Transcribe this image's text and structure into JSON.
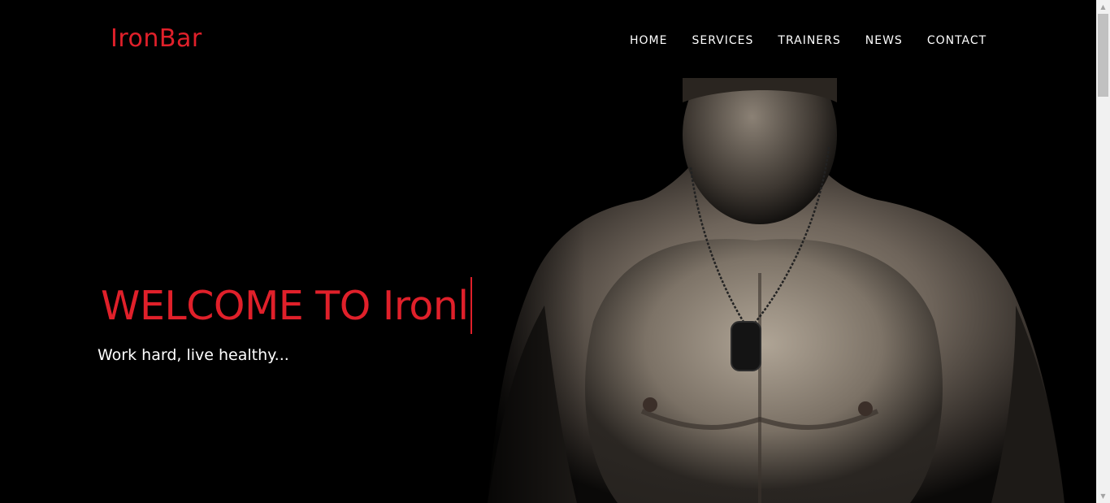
{
  "header": {
    "brand": "IronBar",
    "nav": [
      {
        "label": "HOME"
      },
      {
        "label": "SERVICES"
      },
      {
        "label": "TRAINERS"
      },
      {
        "label": "NEWS"
      },
      {
        "label": "CONTACT"
      }
    ]
  },
  "hero": {
    "title": "WELCOME TO Ironl",
    "subtitle": "Work hard, live healthy..."
  },
  "colors": {
    "accent": "#e0202a",
    "background": "#000000",
    "nav_text": "#ffffff"
  }
}
